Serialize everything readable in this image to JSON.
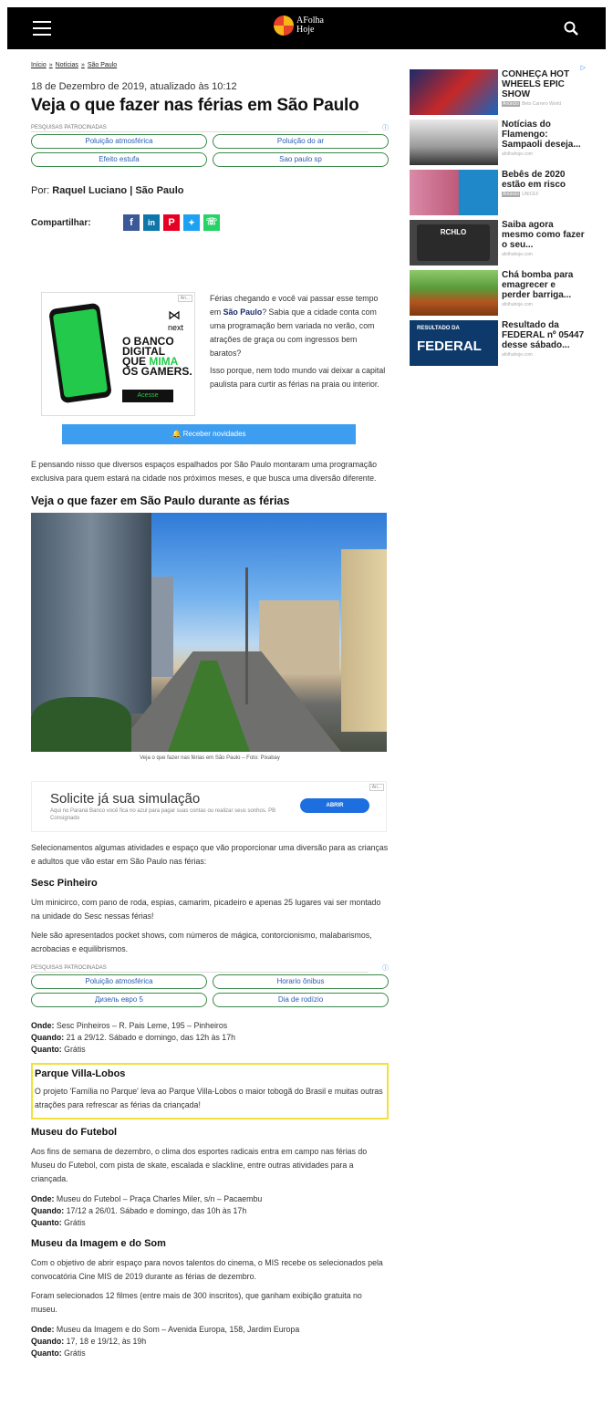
{
  "header": {
    "logo_line1": "AFolha",
    "logo_line2": "Hoje",
    "menu_icon": "hamburger-icon",
    "search_icon": "search-icon"
  },
  "breadcrumb": [
    "Início",
    "Notícias",
    "São Paulo"
  ],
  "article": {
    "date": "18 de Dezembro de 2019, atualizado às 10:12",
    "title": "Veja o que fazer nas férias em São Paulo",
    "byline_prefix": "Por:",
    "author": "Raquel Luciano | São Paulo",
    "share_label": "Compartilhar:",
    "intro_p1_a": "Férias chegando e você vai passar esse tempo em ",
    "intro_p1_link": "São Paulo",
    "intro_p1_b": "? Sabia que a cidade conta com uma programação bem variada no verão, com atrações de graça ou com ingressos bem baratos?",
    "intro_p2": "Isso porque, nem todo mundo vai deixar a capital paulista para curtir as férias na praia ou interior.",
    "notify_label": "Receber novidades",
    "para1": "E pensando nisso que diversos espaços espalhados por São Paulo montaram uma programação exclusiva para quem estará na cidade nos próximos meses, e que busca uma diversão diferente.",
    "section_title": "Veja o que fazer em São Paulo durante as férias",
    "photo_caption": "Veja o que fazer nas férias em São Paulo – Foto: Pixabay",
    "para2": "Selecionamentos algumas atividades e espaço que vão proporcionar uma diversão para as crianças e adultos que vão estar em São Paulo nas férias:",
    "sesc_title": "Sesc Pinheiro",
    "sesc_p1": "Um minicirco, com pano de roda, espias, camarim, picadeiro e apenas 25 lugares vai ser montado na unidade do Sesc nessas férias!",
    "sesc_p2": "Nele são apresentados pocket shows, com números de mágica, contorcionismo, malabarismos, acrobacias e equilibrismos.",
    "sesc_onde_lbl": "Onde:",
    "sesc_onde": " Sesc Pinheiros – R. Pais Leme, 195 – Pinheiros",
    "sesc_quando_lbl": "Quando:",
    "sesc_quando": " 21 a 29/12. Sábado e domingo, das 12h às 17h",
    "sesc_quanto_lbl": "Quanto:",
    "sesc_quanto": " Grátis",
    "villa_title": "Parque Villa-Lobos",
    "villa_p": "O projeto 'Família no Parque' leva ao Parque Villa-Lobos o maior tobogã do Brasil e muitas outras atrações para refrescar as férias da criançada!",
    "futebol_title": "Museu do Futebol",
    "futebol_p": "Aos fins de semana de dezembro, o clima dos esportes radicais entra em campo nas férias do Museu do Futebol, com pista de skate, escalada e slackline, entre outras atividades para a criançada.",
    "futebol_onde_lbl": "Onde:",
    "futebol_onde": " Museu do Futebol – Praça Charles Miler, s/n – Pacaembu",
    "futebol_quando_lbl": "Quando:",
    "futebol_quando": " 17/12 a 26/01. Sábado e domingo, das 10h às 17h",
    "futebol_quanto_lbl": "Quanto:",
    "futebol_quanto": " Grátis",
    "mis_title": "Museu da Imagem e do Som",
    "mis_p1": "Com o objetivo de abrir espaço para novos talentos do cinema, o MIS recebe os selecionados pela convocatória Cine MIS de 2019 durante as férias de dezembro.",
    "mis_p2": "Foram selecionados 12 filmes (entre mais de 300 inscritos), que ganham exibição gratuita no museu.",
    "mis_onde_lbl": "Onde:",
    "mis_onde": " Museu da Imagem e do Som – Avenida Europa, 158, Jardim Europa",
    "mis_quando_lbl": "Quando:",
    "mis_quando": " 17, 18 e 19/12, às 19h",
    "mis_quanto_lbl": "Quanto:",
    "mis_quanto": " Grátis"
  },
  "sponsored1": {
    "label": "PESQUISAS PATROCINADAS",
    "pills": [
      "Poluição atmosférica",
      "Poluição do ar",
      "Efeito estufa",
      "Sao paulo sp"
    ]
  },
  "sponsored2": {
    "label": "PESQUISAS PATROCINADAS",
    "pills": [
      "Poluição atmosférica",
      "Horario ônibus",
      "Дизель евро 5",
      "Dia de rodízio"
    ]
  },
  "ad_banco": {
    "tag": "An...",
    "brand": "next",
    "line1": "O BANCO",
    "line2": "DIGITAL",
    "line3a": "QUE ",
    "line3b": "MIMA",
    "line4": "OS GAMERS.",
    "cta": "Acesse"
  },
  "ad_simulacao": {
    "tag": "An...",
    "title": "Solicite já sua simulação",
    "desc": "Aqui no Paraná Banco você fica no azul para pagar suas contas ou realizar seus sonhos. PB Consignado",
    "cta": "ABRIR"
  },
  "sidebar": [
    {
      "title": "CONHEÇA HOT WHEELS EPIC SHOW",
      "ann": "Anúncio",
      "src": "Beto Carrero World"
    },
    {
      "title": "Notícias do Flamengo: Sampaoli deseja...",
      "ann": "",
      "src": "afolhahoje.com"
    },
    {
      "title": "Bebês de 2020 estão em risco",
      "ann": "Anúncio",
      "src": "UNICEF"
    },
    {
      "title": "Saiba agora mesmo como fazer o seu...",
      "ann": "",
      "src": "afolhahoje.com"
    },
    {
      "title": "Chá bomba para emagrecer e perder barriga...",
      "ann": "",
      "src": "afolhahoje.com"
    },
    {
      "title": "Resultado da FEDERAL nº 05447 desse sábado...",
      "ann": "",
      "src": "afolhahoje.com"
    }
  ],
  "colors": {
    "accent_blue": "#3d9df0",
    "pill_border": "#3a8a4a",
    "highlight": "#f2e13a"
  }
}
